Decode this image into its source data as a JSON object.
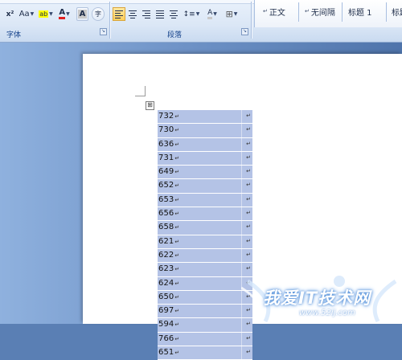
{
  "ribbon": {
    "font_group": {
      "label": "字体",
      "superscript_label": "x²",
      "change_case_label": "Aa",
      "highlight_label": "ab",
      "font_color_label": "A",
      "char_shading_label": "A",
      "enclose_label": "字"
    },
    "paragraph_group": {
      "label": "段落",
      "shading_label": "A"
    },
    "styles_group": {
      "items": [
        "正文",
        "无间隔",
        "标题 1",
        "标题"
      ]
    },
    "launcher_icon": "dialog-launcher-icon",
    "accent": "#15428b"
  },
  "document": {
    "table": {
      "rows": [
        "732",
        "730",
        "636",
        "731",
        "649",
        "652",
        "653",
        "656",
        "658",
        "621",
        "622",
        "623",
        "624",
        "650",
        "697",
        "594",
        "766",
        "651"
      ],
      "cell_mark": "↵",
      "highlight_color": "#b4c3e6"
    },
    "move_handle_label": "⊞"
  },
  "watermark": {
    "text": "我爱IT技术网",
    "url": "www.52ij.com"
  }
}
